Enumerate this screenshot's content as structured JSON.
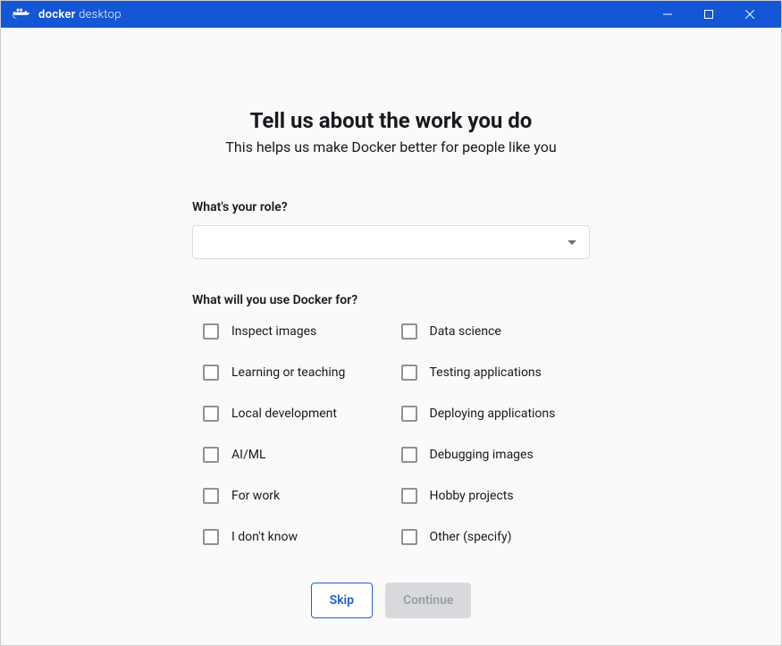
{
  "titlebar": {
    "brand_bold": "docker",
    "brand_light": "desktop"
  },
  "survey": {
    "heading": "Tell us about the work you do",
    "subheading": "This helps us make Docker better for people like you",
    "role_label": "What's your role?",
    "use_label": "What will you use Docker for?",
    "options": {
      "inspect": "Inspect images",
      "data_science": "Data science",
      "learning": "Learning or teaching",
      "testing": "Testing applications",
      "local_dev": "Local development",
      "deploying": "Deploying applications",
      "aiml": "AI/ML",
      "debugging": "Debugging images",
      "work": "For work",
      "hobby": "Hobby projects",
      "dont_know": "I don't know",
      "other": "Other (specify)"
    }
  },
  "buttons": {
    "skip": "Skip",
    "continue": "Continue"
  }
}
